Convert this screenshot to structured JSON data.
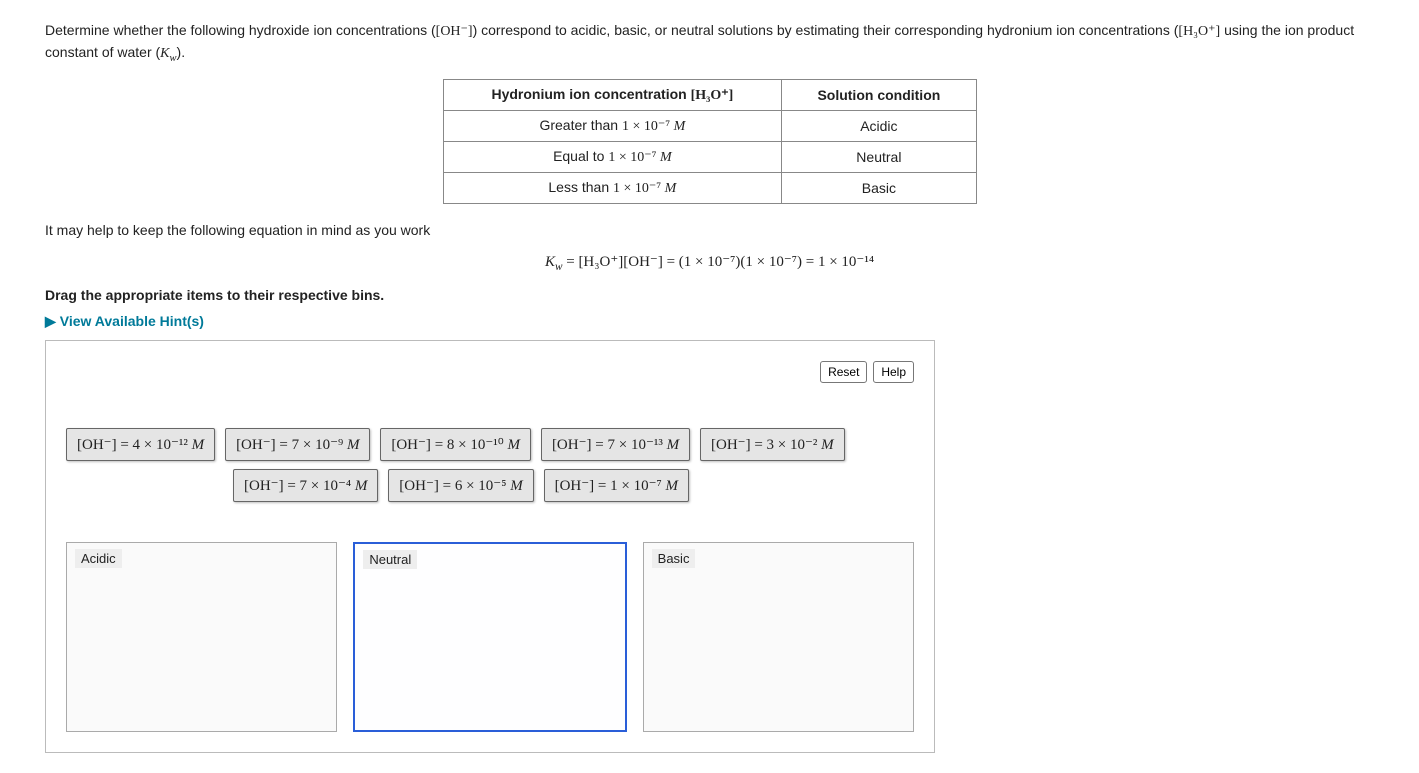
{
  "prompt": {
    "p1a": "Determine whether the following hydroxide ion concentrations (",
    "p1b": ") correspond to acidic, basic, or neutral solutions by estimating their corresponding hydronium ion concentrations (",
    "p1c": " using the ion product constant of water (",
    "p1d": ").",
    "oh": "[OH⁻]",
    "h3o": "[H₃O⁺]",
    "kw": "K",
    "kw_sub": "w"
  },
  "table": {
    "h1a": "Hydronium ion concentration ",
    "h1b": "[H₃O⁺]",
    "h2": "Solution condition",
    "rows": [
      {
        "c_pre": "Greater than ",
        "c_num": "1 × 10⁻⁷",
        "c_unit": " M",
        "cond": "Acidic"
      },
      {
        "c_pre": "Equal to ",
        "c_num": "1 × 10⁻⁷",
        "c_unit": " M",
        "cond": "Neutral"
      },
      {
        "c_pre": "Less than ",
        "c_num": "1 × 10⁻⁷",
        "c_unit": " M",
        "cond": "Basic"
      }
    ]
  },
  "hint_text": "It may help to keep the following equation in mind as you work",
  "equation": {
    "lhs_k": "K",
    "lhs_sub": "w",
    "eq": " = ",
    "mid": "[H₃O⁺][OH⁻]",
    "rhs1": "(1 × 10⁻⁷)(1 × 10⁻⁷)",
    "rhs2": "1 × 10⁻¹⁴"
  },
  "instruction": "Drag the appropriate items to their respective bins.",
  "hints_link": "View Available Hint(s)",
  "buttons": {
    "reset": "Reset",
    "help": "Help"
  },
  "items_row1": [
    {
      "label": "[OH⁻]",
      "eq": " = ",
      "coef": "4 × 10⁻¹²",
      "unit": " M"
    },
    {
      "label": "[OH⁻]",
      "eq": " = ",
      "coef": "7 × 10⁻⁹",
      "unit": " M"
    },
    {
      "label": "[OH⁻]",
      "eq": " = ",
      "coef": "8 × 10⁻¹⁰",
      "unit": " M"
    },
    {
      "label": "[OH⁻]",
      "eq": " = ",
      "coef": "7 × 10⁻¹³",
      "unit": " M"
    },
    {
      "label": "[OH⁻]",
      "eq": " = ",
      "coef": "3 × 10⁻²",
      "unit": " M"
    }
  ],
  "items_row2": [
    {
      "label": "[OH⁻]",
      "eq": " = ",
      "coef": "7 × 10⁻⁴",
      "unit": " M"
    },
    {
      "label": "[OH⁻]",
      "eq": " = ",
      "coef": "6 × 10⁻⁵",
      "unit": " M"
    },
    {
      "label": "[OH⁻]",
      "eq": " = ",
      "coef": "1 × 10⁻⁷",
      "unit": " M"
    }
  ],
  "bins": [
    {
      "label": "Acidic",
      "selected": false
    },
    {
      "label": "Neutral",
      "selected": true
    },
    {
      "label": "Basic",
      "selected": false
    }
  ]
}
